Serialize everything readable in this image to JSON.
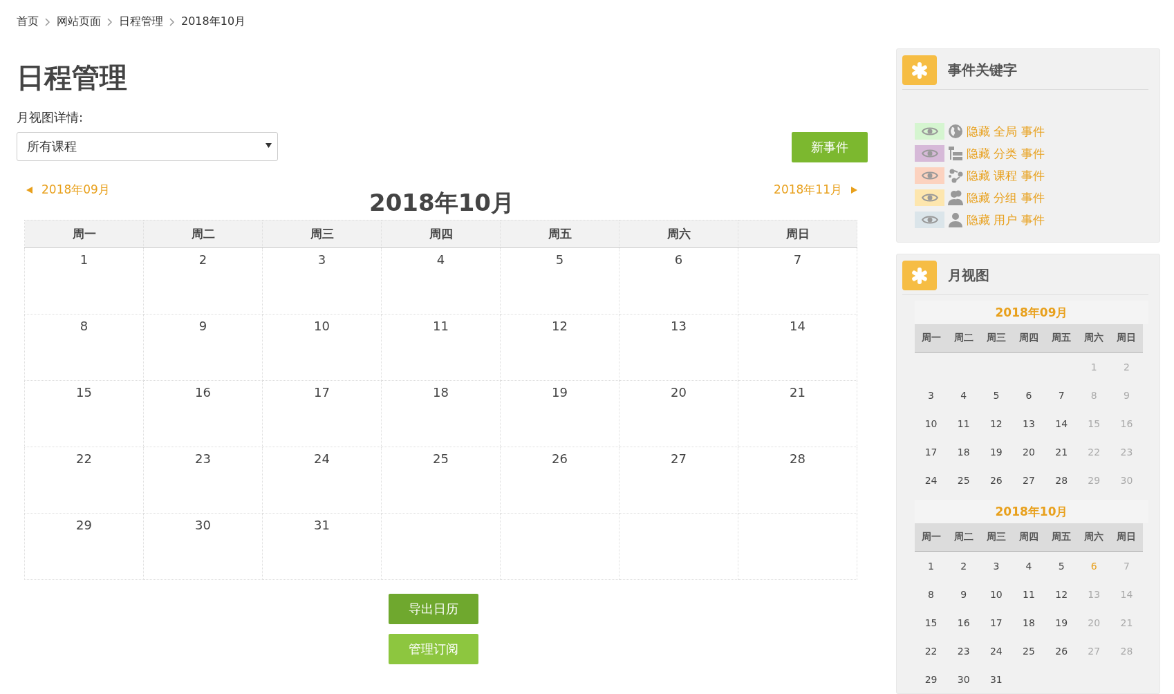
{
  "breadcrumbs": [
    "首页",
    "网站页面",
    "日程管理",
    "2018年10月"
  ],
  "title": "日程管理",
  "filter": {
    "label": "月视图详情:",
    "value": "所有课程"
  },
  "new_event_button": "新事件",
  "calendar": {
    "prev": "2018年09月",
    "next": "2018年11月",
    "month_title": "2018年10月",
    "weekdays": [
      "周一",
      "周二",
      "周三",
      "周四",
      "周五",
      "周六",
      "周日"
    ],
    "weeks": [
      [
        "1",
        "2",
        "3",
        "4",
        "5",
        "6",
        "7"
      ],
      [
        "8",
        "9",
        "10",
        "11",
        "12",
        "13",
        "14"
      ],
      [
        "15",
        "16",
        "17",
        "18",
        "19",
        "20",
        "21"
      ],
      [
        "22",
        "23",
        "24",
        "25",
        "26",
        "27",
        "28"
      ],
      [
        "29",
        "30",
        "31"
      ]
    ]
  },
  "buttons": [
    {
      "label": "导出日历",
      "kind": "primary"
    },
    {
      "label": "管理订阅",
      "kind": "secondary"
    }
  ],
  "keywords_panel": {
    "title": "事件关键字",
    "items": [
      {
        "label": "隐藏 全局 事件",
        "kind": "site",
        "color": "#d5f5d0"
      },
      {
        "label": "隐藏 分类 事件",
        "kind": "category",
        "color": "#d6b9d8"
      },
      {
        "label": "隐藏 课程 事件",
        "kind": "course",
        "color": "#fcd2bf"
      },
      {
        "label": "隐藏 分组 事件",
        "kind": "group",
        "color": "#fde6ae"
      },
      {
        "label": "隐藏 用户 事件",
        "kind": "user",
        "color": "#dbe5ea"
      }
    ]
  },
  "month_panel": {
    "title": "月视图",
    "calendars": [
      {
        "title": "2018年09月",
        "weekdays": [
          "周一",
          "周二",
          "周三",
          "周四",
          "周五",
          "周六",
          "周日"
        ],
        "weeks": [
          [
            {
              "kind": "blank"
            },
            {
              "kind": "blank"
            },
            {
              "kind": "blank"
            },
            {
              "kind": "blank"
            },
            {
              "kind": "blank"
            },
            {
              "day": "1",
              "kind": "weekend"
            },
            {
              "day": "2",
              "kind": "weekend"
            }
          ],
          [
            {
              "day": "3",
              "kind": "weekday"
            },
            {
              "day": "4",
              "kind": "weekday"
            },
            {
              "day": "5",
              "kind": "weekday"
            },
            {
              "day": "6",
              "kind": "weekday"
            },
            {
              "day": "7",
              "kind": "weekday"
            },
            {
              "day": "8",
              "kind": "weekend"
            },
            {
              "day": "9",
              "kind": "weekend"
            }
          ],
          [
            {
              "day": "10",
              "kind": "weekday"
            },
            {
              "day": "11",
              "kind": "weekday"
            },
            {
              "day": "12",
              "kind": "weekday"
            },
            {
              "day": "13",
              "kind": "weekday"
            },
            {
              "day": "14",
              "kind": "weekday"
            },
            {
              "day": "15",
              "kind": "weekend"
            },
            {
              "day": "16",
              "kind": "weekend"
            }
          ],
          [
            {
              "day": "17",
              "kind": "weekday"
            },
            {
              "day": "18",
              "kind": "weekday"
            },
            {
              "day": "19",
              "kind": "weekday"
            },
            {
              "day": "20",
              "kind": "weekday"
            },
            {
              "day": "21",
              "kind": "weekday"
            },
            {
              "day": "22",
              "kind": "weekend"
            },
            {
              "day": "23",
              "kind": "weekend"
            }
          ],
          [
            {
              "day": "24",
              "kind": "weekday"
            },
            {
              "day": "25",
              "kind": "weekday"
            },
            {
              "day": "26",
              "kind": "weekday"
            },
            {
              "day": "27",
              "kind": "weekday"
            },
            {
              "day": "28",
              "kind": "weekday"
            },
            {
              "day": "29",
              "kind": "weekend"
            },
            {
              "day": "30",
              "kind": "weekend"
            }
          ]
        ]
      },
      {
        "title": "2018年10月",
        "weekdays": [
          "周一",
          "周二",
          "周三",
          "周四",
          "周五",
          "周六",
          "周日"
        ],
        "weeks": [
          [
            {
              "day": "1",
              "kind": "weekday"
            },
            {
              "day": "2",
              "kind": "weekday"
            },
            {
              "day": "3",
              "kind": "weekday"
            },
            {
              "day": "4",
              "kind": "weekday"
            },
            {
              "day": "5",
              "kind": "weekday"
            },
            {
              "day": "6",
              "kind": "today"
            },
            {
              "day": "7",
              "kind": "weekend"
            }
          ],
          [
            {
              "day": "8",
              "kind": "weekday"
            },
            {
              "day": "9",
              "kind": "weekday"
            },
            {
              "day": "10",
              "kind": "weekday"
            },
            {
              "day": "11",
              "kind": "weekday"
            },
            {
              "day": "12",
              "kind": "weekday"
            },
            {
              "day": "13",
              "kind": "weekend"
            },
            {
              "day": "14",
              "kind": "weekend"
            }
          ],
          [
            {
              "day": "15",
              "kind": "weekday"
            },
            {
              "day": "16",
              "kind": "weekday"
            },
            {
              "day": "17",
              "kind": "weekday"
            },
            {
              "day": "18",
              "kind": "weekday"
            },
            {
              "day": "19",
              "kind": "weekday"
            },
            {
              "day": "20",
              "kind": "weekend"
            },
            {
              "day": "21",
              "kind": "weekend"
            }
          ],
          [
            {
              "day": "22",
              "kind": "weekday"
            },
            {
              "day": "23",
              "kind": "weekday"
            },
            {
              "day": "24",
              "kind": "weekday"
            },
            {
              "day": "25",
              "kind": "weekday"
            },
            {
              "day": "26",
              "kind": "weekday"
            },
            {
              "day": "27",
              "kind": "weekend"
            },
            {
              "day": "28",
              "kind": "weekend"
            }
          ],
          [
            {
              "day": "29",
              "kind": "weekday"
            },
            {
              "day": "30",
              "kind": "weekday"
            },
            {
              "day": "31",
              "kind": "weekday"
            }
          ]
        ]
      }
    ]
  }
}
